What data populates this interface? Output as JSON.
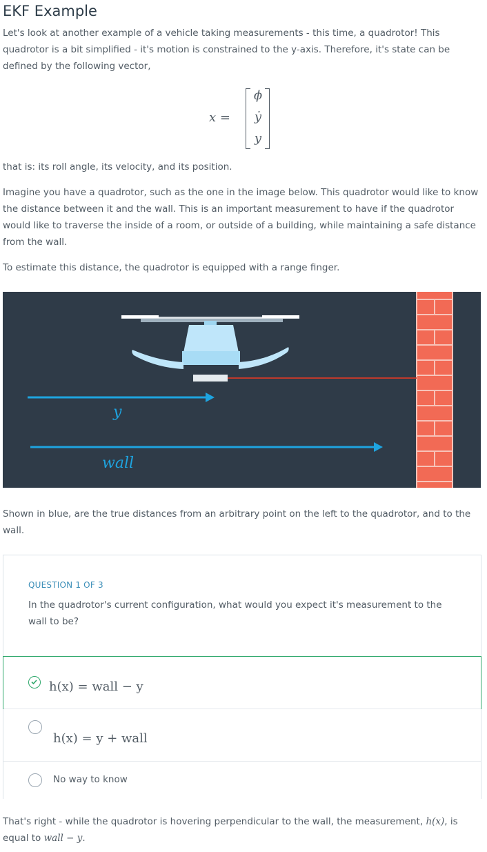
{
  "title": "EKF Example",
  "intro": "Let's look at another example of a vehicle taking measurements - this time, a quadrotor! This quadrotor is a bit simplified - it's motion is constrained to the y-axis. Therefore, it's state can be defined by the following vector,",
  "equation": {
    "lhs": "x",
    "equals": "=",
    "entries": [
      "ϕ",
      "ẏ",
      "y"
    ]
  },
  "state_explanation": "that is: its roll angle, its velocity, and its position.",
  "imagine_paragraph": "Imagine you have a quadrotor, such as the one in the image below. This quadrotor would like to know the distance between it and the wall. This is an important measurement to have if the quadrotor would like to traverse the inside of a room, or outside of a building, while maintaining a safe distance from the wall.",
  "range_finger_paragraph": "To estimate this distance, the quadrotor is equipped with a range finger.",
  "figure": {
    "label_y": "y",
    "label_wall": "wall",
    "arrow_color": "#1ea4e0",
    "background": "#2f3b48",
    "laser_color": "#c0392b",
    "brick_color": "#ef5b46"
  },
  "caption": "Shown in blue, are the true distances from an arbitrary point on the left to the quadrotor, and to the wall.",
  "quiz": {
    "header": "QUESTION 1 OF 3",
    "question": "In the quadrotor's current configuration, what would you expect it's measurement to the wall to be?",
    "options": [
      {
        "label": "h(x) = wall − y",
        "selected": true
      },
      {
        "label": "h(x) = y + wall",
        "selected": false
      },
      {
        "label": "No way to know",
        "selected": false
      }
    ],
    "accent_color": "#2ea86b"
  },
  "feedback": {
    "text1": "That's right - while the quadrotor is hovering perpendicular to the wall, the measurement,",
    "math1": "h(x)",
    "text2": ", is equal to",
    "math2": "wall − y",
    "text3": "."
  }
}
